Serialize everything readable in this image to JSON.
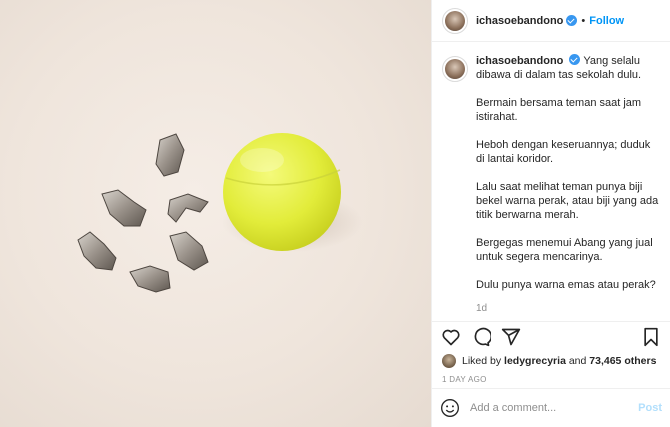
{
  "header": {
    "username": "ichasoebandono",
    "separator": "•",
    "follow_label": "Follow"
  },
  "caption": {
    "username": "ichasoebandono",
    "paragraphs": [
      "Yang selalu dibawa di dalam tas sekolah dulu.",
      "Bermain bersama teman saat jam istirahat.",
      "Heboh dengan keseruannya; duduk di lantai koridor.",
      "Lalu saat melihat teman punya biji bekel warna perak, atau biji yang ada titik berwarna merah.",
      "Bergegas menemui Abang yang jual untuk segera mencarinya.",
      "Dulu punya warna emas atau perak?"
    ],
    "time": "1d"
  },
  "actions": {
    "icons": [
      "heart-icon",
      "comment-icon",
      "share-icon",
      "bookmark-icon"
    ]
  },
  "likes": {
    "prefix": "Liked by",
    "user": "ledygrecyria",
    "joiner": "and",
    "count": "73,465 others"
  },
  "posted_ago": "1 DAY AGO",
  "comment_box": {
    "placeholder": "Add a comment...",
    "post_label": "Post"
  },
  "colors": {
    "accent": "#0095f6",
    "post_disabled": "#b2dffc",
    "ball": "#e6f04a"
  }
}
